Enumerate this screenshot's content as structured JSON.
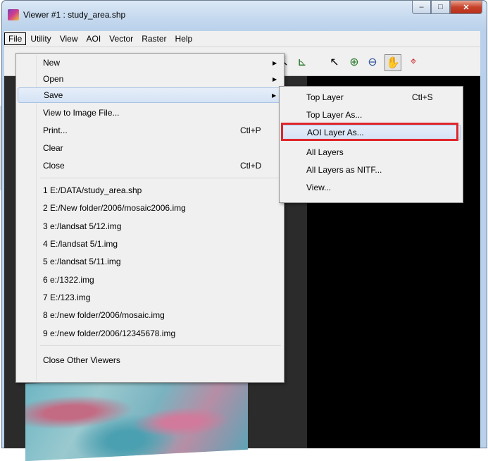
{
  "window": {
    "title": "Viewer #1 : study_area.shp",
    "app_icon": "erdas-viewer-icon"
  },
  "window_controls": {
    "minimize": "–",
    "maximize": "□",
    "close": "✕"
  },
  "menubar": [
    "File",
    "Utility",
    "View",
    "AOI",
    "Vector",
    "Raster",
    "Help"
  ],
  "toolbar": {
    "icons": [
      "arrow-icon",
      "profile-icon",
      "select-pointer-icon",
      "zoom-in-icon",
      "zoom-out-icon",
      "pan-hand-icon",
      "inquire-cursor-icon"
    ],
    "glyphs": [
      "↖",
      "⊾",
      "↖",
      "⊕",
      "⊖",
      "✋",
      "⌖"
    ]
  },
  "file_menu": {
    "items": [
      {
        "label": "New",
        "shortcut": "",
        "submenu": true
      },
      {
        "label": "Open",
        "shortcut": "",
        "submenu": true
      },
      {
        "label": "Save",
        "shortcut": "",
        "submenu": true,
        "highlighted": true
      },
      {
        "label": "View to Image File...",
        "shortcut": ""
      },
      {
        "label": "Print...",
        "shortcut": "Ctl+P"
      },
      {
        "label": "Clear",
        "shortcut": ""
      },
      {
        "label": "Close",
        "shortcut": "Ctl+D"
      }
    ],
    "recent": [
      "1 E:/DATA/study_area.shp",
      "2 E:/New folder/2006/mosaic2006.img",
      "3 e:/landsat 5/12.img",
      "4 E:/landsat 5/1.img",
      "5 e:/landsat 5/11.img",
      "6 e:/1322.img",
      "7 E:/123.img",
      "8 e:/new folder/2006/mosaic.img",
      "9 e:/new folder/2006/12345678.img"
    ],
    "close_others": "Close Other Viewers"
  },
  "save_menu": {
    "items": [
      {
        "label": "Top Layer",
        "shortcut": "Ctl+S"
      },
      {
        "label": "Top Layer As...",
        "shortcut": ""
      },
      {
        "label": "AOI Layer As...",
        "shortcut": "",
        "highlighted": true
      },
      {
        "label": "All Layers",
        "shortcut": ""
      },
      {
        "label": "All Layers as NITF...",
        "shortcut": ""
      },
      {
        "label": "View...",
        "shortcut": ""
      }
    ]
  },
  "colors": {
    "highlight_box": "#e0262b",
    "menu_bg": "#f0f0f0",
    "viewer_bg": "#000000"
  }
}
